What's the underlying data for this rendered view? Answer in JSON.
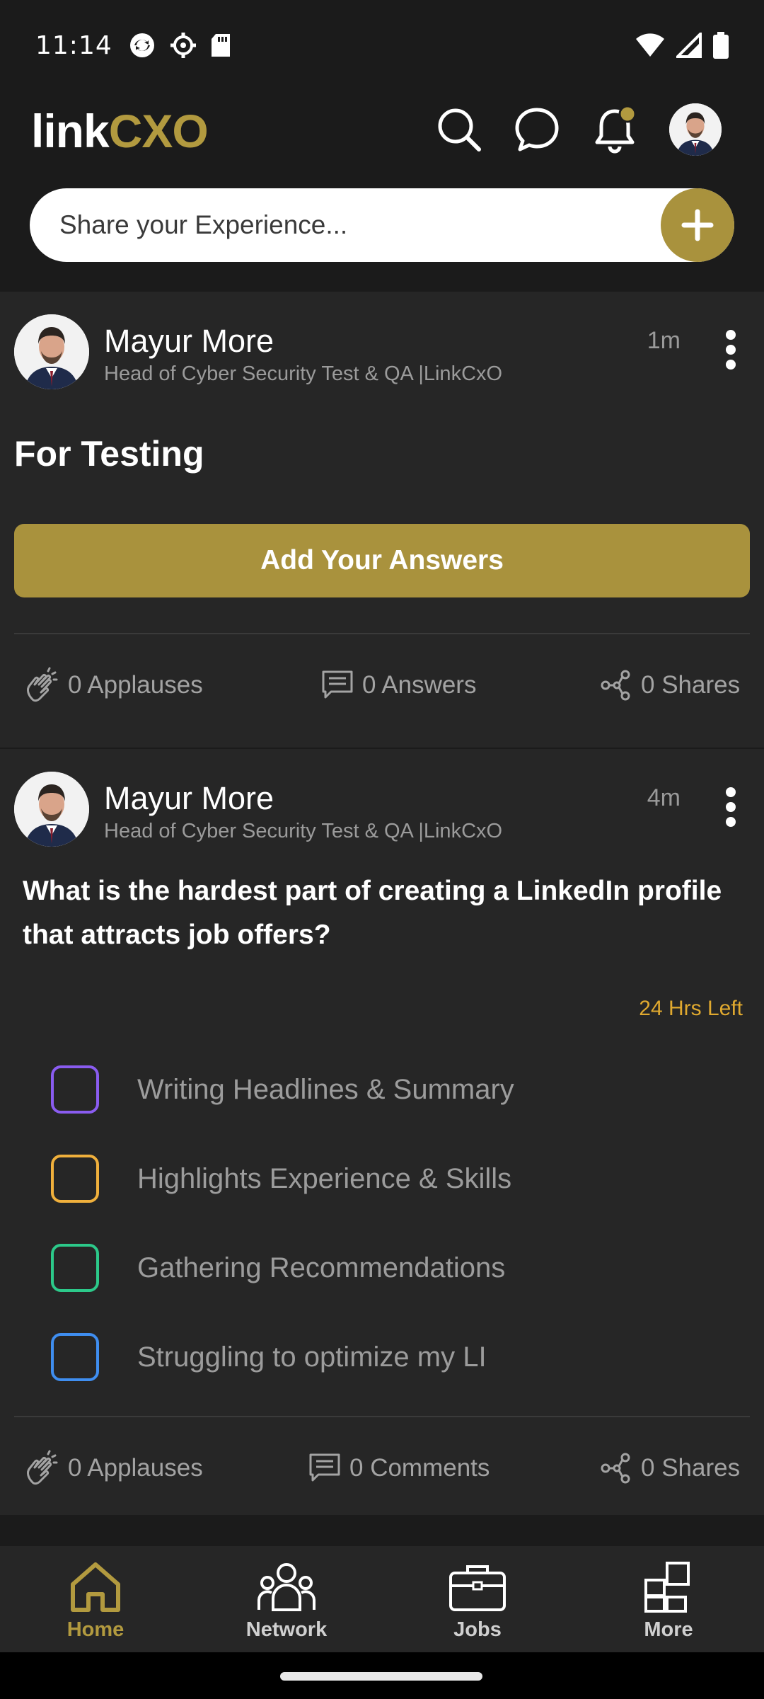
{
  "status_bar": {
    "time": "11:14",
    "icons": [
      "sync-icon",
      "settings-icon",
      "sd-card-icon",
      "wifi-icon",
      "signal-icon",
      "battery-icon"
    ]
  },
  "app_bar": {
    "logo_link": "link",
    "logo_cxo": "CXO",
    "icons": [
      "search-icon",
      "chat-icon",
      "notification-bell-icon",
      "profile-avatar"
    ]
  },
  "share": {
    "placeholder": "Share your Experience..."
  },
  "posts": [
    {
      "author": "Mayur More",
      "headline": "Head of Cyber Security Test & QA |LinkCxO",
      "time": "1m",
      "title": "For Testing",
      "cta": "Add Your Answers",
      "stats": {
        "applauses": "0 Applauses",
        "answers": "0 Answers",
        "shares": "0 Shares"
      }
    },
    {
      "author": "Mayur More",
      "headline": "Head of Cyber Security Test & QA |LinkCxO",
      "time": "4m",
      "question": "What is the hardest part of creating a LinkedIn profile that attracts job offers?",
      "time_left": "24 Hrs Left",
      "options": [
        {
          "label": "Writing Headlines & Summary",
          "color": "#8a5cf0"
        },
        {
          "label": "Highlights Experience & Skills",
          "color": "#f0b03c"
        },
        {
          "label": "Gathering Recommendations",
          "color": "#2cc98a"
        },
        {
          "label": "Struggling to optimize my LI",
          "color": "#3f8ef0"
        }
      ],
      "stats": {
        "applauses": "0 Applauses",
        "comments": "0 Comments",
        "shares": "0 Shares"
      }
    }
  ],
  "bottom_nav": {
    "active_color": "#b29a3f",
    "items": [
      {
        "label": "Home",
        "icon": "home-icon",
        "active": true
      },
      {
        "label": "Network",
        "icon": "network-icon",
        "active": false
      },
      {
        "label": "Jobs",
        "icon": "briefcase-icon",
        "active": false
      },
      {
        "label": "More",
        "icon": "grid-icon",
        "active": false
      }
    ]
  }
}
